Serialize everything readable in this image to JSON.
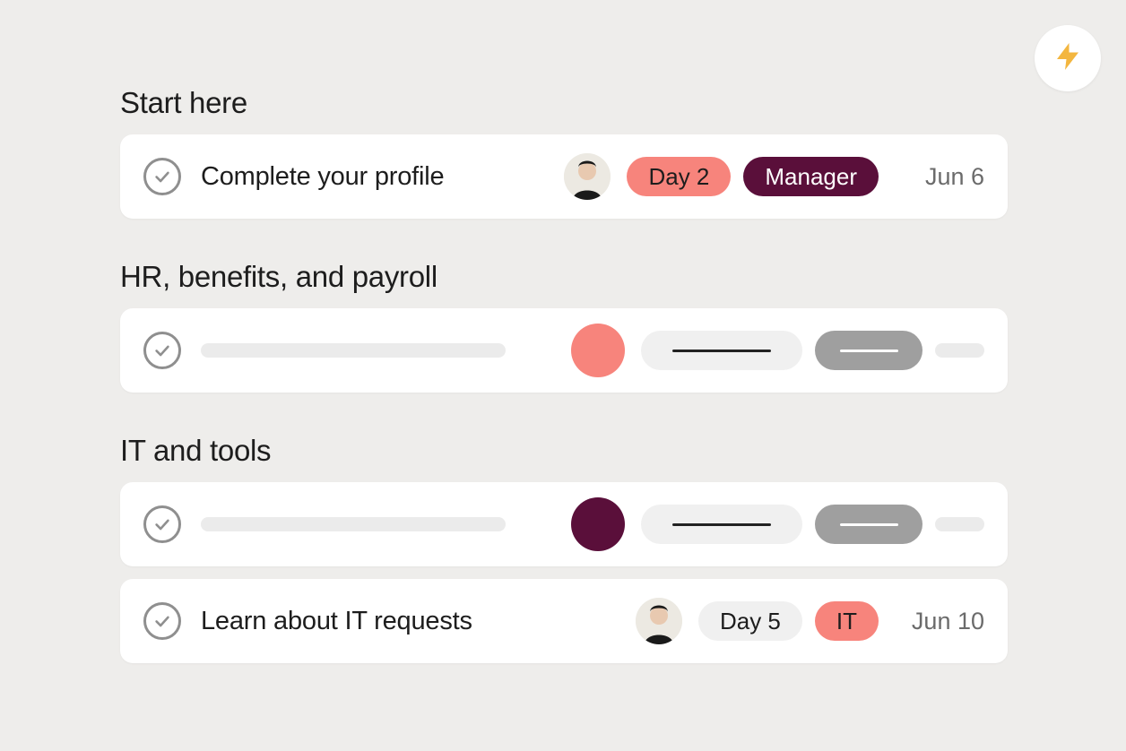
{
  "colors": {
    "coral": "#f7847c",
    "coralLight": "#f9a49c",
    "maroon": "#5a0f3a",
    "grey": "#6b6b6b",
    "pillGrey": "#f0f0f0"
  },
  "fab": {
    "icon": "lightning"
  },
  "sections": [
    {
      "title": "Start here",
      "tasks": [
        {
          "type": "real",
          "title": "Complete your profile",
          "avatar": true,
          "tags": [
            {
              "label": "Day 2",
              "bg": "#f7847c",
              "fg": "#1d1d1d"
            },
            {
              "label": "Manager",
              "bg": "#5a0f3a",
              "fg": "#ffffff"
            }
          ],
          "date": "Jun 6"
        }
      ]
    },
    {
      "title": "HR, benefits, and payroll",
      "tasks": [
        {
          "type": "placeholder",
          "dotColor": "#f7847c"
        }
      ]
    },
    {
      "title": "IT and tools",
      "tasks": [
        {
          "type": "placeholder",
          "dotColor": "#5a0f3a"
        },
        {
          "type": "real",
          "title": "Learn about IT requests",
          "avatar": true,
          "tags": [
            {
              "label": "Day 5",
              "bg": "#f0f0f0",
              "fg": "#1d1d1d"
            },
            {
              "label": "IT",
              "bg": "#f7847c",
              "fg": "#1d1d1d"
            }
          ],
          "date": "Jun 10"
        }
      ]
    }
  ]
}
